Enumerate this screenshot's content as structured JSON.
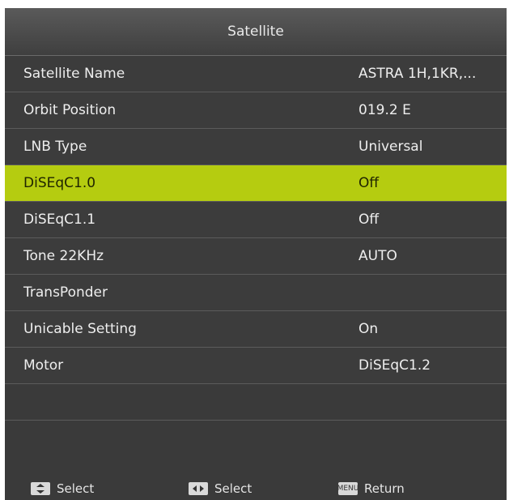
{
  "title": "Satellite",
  "menu_items": [
    {
      "label": "Satellite Name",
      "value": "ASTRA 1H,1KR,...",
      "selected": false
    },
    {
      "label": "Orbit Position",
      "value": "019.2 E",
      "selected": false
    },
    {
      "label": "LNB Type",
      "value": "Universal",
      "selected": false
    },
    {
      "label": "DiSEqC1.0",
      "value": "Off",
      "selected": true
    },
    {
      "label": "DiSEqC1.1",
      "value": "Off",
      "selected": false
    },
    {
      "label": "Tone 22KHz",
      "value": "AUTO",
      "selected": false
    },
    {
      "label": "TransPonder",
      "value": "",
      "selected": false
    },
    {
      "label": "Unicable Setting",
      "value": "On",
      "selected": false
    },
    {
      "label": "Motor",
      "value": "DiSEqC1.2",
      "selected": false
    }
  ],
  "footer": {
    "hint1_icon": "up-down-arrows-icon",
    "hint1_label": "Select",
    "hint2_icon": "left-right-arrows-icon",
    "hint2_label": "Select",
    "hint3_icon": "menu-key-icon",
    "hint3_key_text": "MENU",
    "hint3_label": "Return"
  },
  "colors": {
    "selected_row": "#b5cc10",
    "panel_bg": "#3a3a3a",
    "text": "#eeeeee"
  }
}
